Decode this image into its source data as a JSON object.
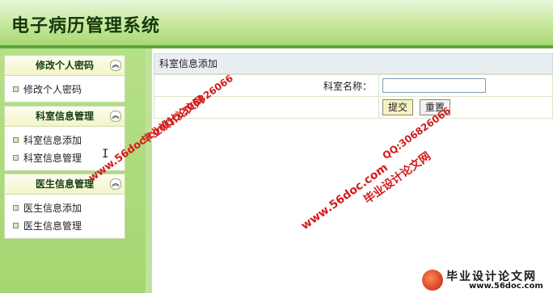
{
  "app": {
    "title": "电子病历管理系统"
  },
  "sidebar": {
    "panels": [
      {
        "title": "修改个人密码",
        "items": [
          "修改个人密码"
        ]
      },
      {
        "title": "科室信息管理",
        "items": [
          "科室信息添加",
          "科室信息管理"
        ]
      },
      {
        "title": "医生信息管理",
        "items": [
          "医生信息添加",
          "医生信息管理"
        ]
      }
    ],
    "collapse_glyph": "︽"
  },
  "main": {
    "section_title": "科室信息添加",
    "form": {
      "field_label": "科室名称：",
      "field_value": "",
      "submit_label": "提交",
      "reset_label": "重置"
    }
  },
  "watermarks": {
    "site": "www.56doc.com",
    "qq": "QQ:306826066",
    "name": "毕业设计论文网"
  },
  "logo": {
    "big": "毕业设计论文网",
    "small": "www.56doc.com"
  },
  "colors": {
    "header_text": "#143a0e",
    "accent_green": "#5aa63a",
    "watermark": "#d31b1b"
  }
}
